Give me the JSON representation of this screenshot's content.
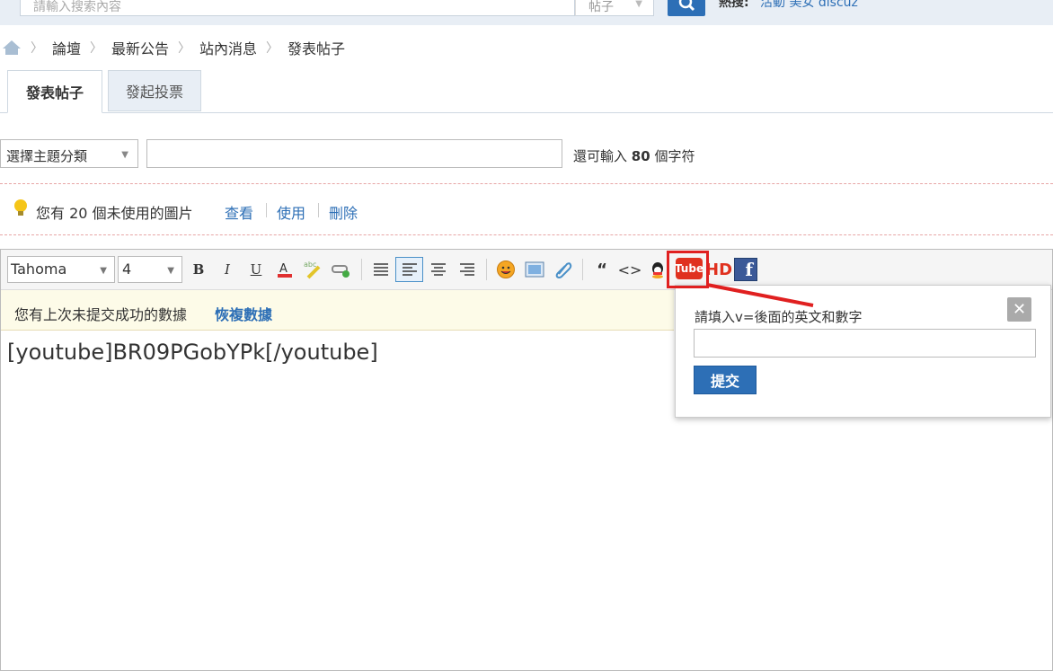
{
  "search": {
    "placeholder": "請輸入搜索內容",
    "type": "帖子",
    "hot_label": "熱搜:",
    "hot_links": "活動  美女  discuz"
  },
  "breadcrumb": [
    "論壇",
    "最新公告",
    "站內消息",
    "發表帖子"
  ],
  "tabs": [
    {
      "label": "發表帖子",
      "active": true
    },
    {
      "label": "發起投票",
      "active": false
    }
  ],
  "form": {
    "category_placeholder": "選擇主題分類",
    "char_count_prefix": "還可輸入",
    "char_count_value": "80",
    "char_count_suffix": "個字符"
  },
  "notice": {
    "text_prefix": "您有",
    "count": "20",
    "text_suffix": "個未使用的圖片",
    "links": [
      "查看",
      "使用",
      "刪除"
    ]
  },
  "editor": {
    "font": "Tahoma",
    "size": "4",
    "toolbar_icons": [
      "bold-icon",
      "italic-icon",
      "underline-icon",
      "font-color-icon",
      "highlight-icon",
      "link-icon",
      "justify-icon",
      "align-left-icon",
      "align-center-icon",
      "align-right-icon",
      "smiley-icon",
      "image-icon",
      "attachment-icon",
      "quote-icon",
      "code-icon",
      "qq-icon",
      "youtube-icon",
      "hd-icon",
      "facebook-icon"
    ],
    "restore_text": "您有上次未提交成功的數據",
    "restore_link": "恢複數據",
    "content": "[youtube]BR09PGobYPk[/youtube]"
  },
  "popup": {
    "label": "請填入v=後面的英文和數字",
    "close": "✕",
    "submit": "提交"
  },
  "colors": {
    "accent": "#2d6fb6",
    "highlight": "#e02020"
  }
}
